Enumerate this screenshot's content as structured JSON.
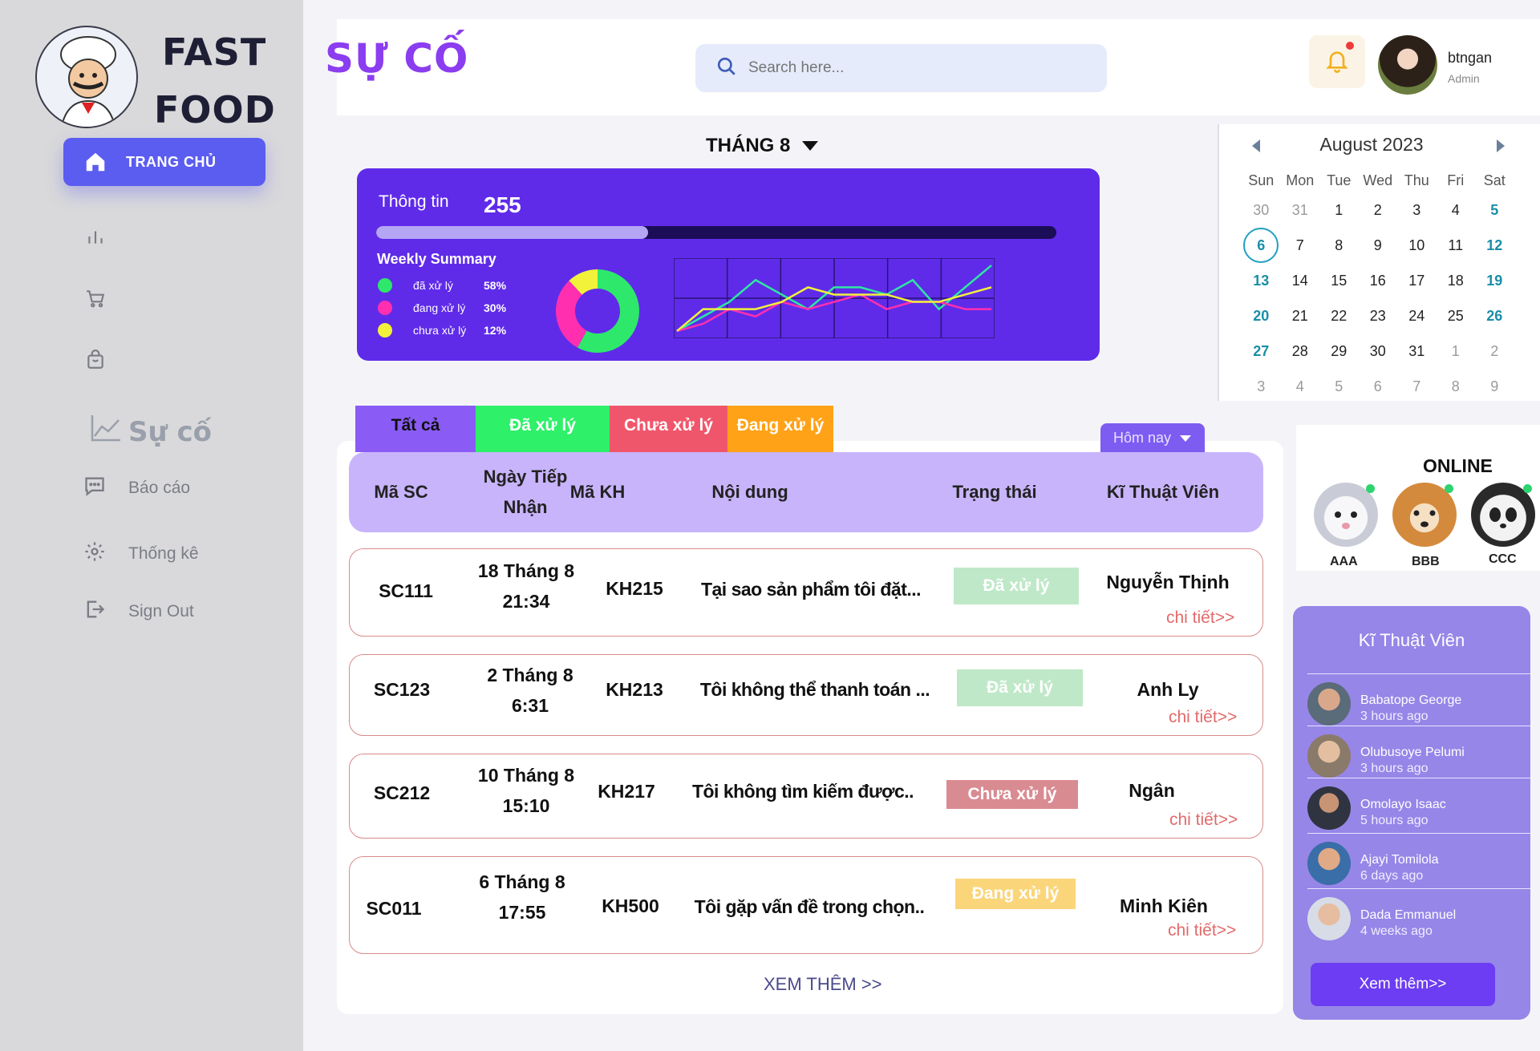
{
  "brand": {
    "line1": "FAST",
    "line2": "FOOD"
  },
  "sidebar": {
    "home_label": "TRANG CHỦ",
    "active_section": "Sự cố",
    "items": [
      {
        "label": "Báo cáo",
        "icon": "chat-icon"
      },
      {
        "label": "Thống kê",
        "icon": "gear-icon"
      },
      {
        "label": "Sign Out",
        "icon": "sign-out-icon"
      }
    ]
  },
  "header": {
    "page_title": "SỰ CỐ",
    "search_placeholder": "Search here...",
    "user_name": "btngan",
    "user_role": "Admin"
  },
  "month_selector": "THÁNG 8",
  "summary": {
    "info_label": "Thông tin",
    "info_value": "255",
    "progress": 0.4,
    "weekly_title": "Weekly Summary",
    "legend": [
      {
        "label": "đã xử lý",
        "pct": "58%",
        "color": "#2ee86b"
      },
      {
        "label": "đang xử lý",
        "pct": "30%",
        "color": "#ff2fb0"
      },
      {
        "label": "chưa xử lý",
        "pct": "12%",
        "color": "#f2f23a"
      }
    ]
  },
  "chart_data": [
    {
      "type": "pie",
      "series": [
        {
          "name": "đã xử lý",
          "value": 58
        },
        {
          "name": "đang xử lý",
          "value": 30
        },
        {
          "name": "chưa xử lý",
          "value": 12
        }
      ]
    },
    {
      "type": "line",
      "x": [
        0,
        1,
        2,
        3,
        4,
        5,
        6,
        7,
        8,
        9,
        10,
        11,
        12
      ],
      "series": [
        {
          "color": "#2ee8a0",
          "values": [
            1,
            3,
            5,
            8,
            6,
            4,
            7,
            7,
            6,
            8,
            4,
            7,
            10
          ]
        },
        {
          "color": "#ff2fb0",
          "values": [
            1,
            2,
            4,
            3,
            5,
            4,
            5,
            6,
            4,
            5,
            5,
            4,
            4
          ]
        },
        {
          "color": "#f2f23a",
          "values": [
            1,
            4,
            4,
            4,
            5,
            7,
            6,
            6,
            6,
            5,
            5,
            6,
            7
          ]
        }
      ],
      "ylim": [
        0,
        11
      ]
    }
  ],
  "calendar": {
    "title": "August 2023",
    "days": [
      "Sun",
      "Mon",
      "Tue",
      "Wed",
      "Thu",
      "Fri",
      "Sat"
    ],
    "weeks": [
      [
        "30",
        "31",
        "1",
        "2",
        "3",
        "4",
        "5"
      ],
      [
        "6",
        "7",
        "8",
        "9",
        "10",
        "11",
        "12"
      ],
      [
        "13",
        "14",
        "15",
        "16",
        "17",
        "18",
        "19"
      ],
      [
        "20",
        "21",
        "22",
        "23",
        "24",
        "25",
        "26"
      ],
      [
        "27",
        "28",
        "29",
        "30",
        "31",
        "1",
        "2"
      ],
      [
        "3",
        "4",
        "5",
        "6",
        "7",
        "8",
        "9"
      ]
    ],
    "today": "6"
  },
  "tabs": [
    {
      "label": "Tất cả",
      "bg": "#8a5cf5",
      "color": "#111"
    },
    {
      "label": "Đã xử lý",
      "bg": "#2ef069",
      "color": "#fff"
    },
    {
      "label": "Chưa xử lý",
      "bg": "#f0566b",
      "color": "#fff"
    },
    {
      "label": "Đang xử lý",
      "bg": "#ffa217",
      "color": "#fff"
    }
  ],
  "date_filter": "Hôm nay",
  "table": {
    "headers": [
      "Mã SC",
      "Ngày Tiếp Nhận",
      "Mã KH",
      "Nội dung",
      "Trạng thái",
      "Kĩ Thuật Viên"
    ],
    "detail_label": "chi tiết>>",
    "rows": [
      {
        "id": "SC111",
        "date": "18 Tháng 8",
        "time": "21:34",
        "customer": "KH215",
        "content": "Tại sao sản phẩm tôi đặt...",
        "status": "Đã xử lý",
        "status_color": "#bfe8c8",
        "tech": "Nguyễn Thịnh"
      },
      {
        "id": "SC123",
        "date": "2 Tháng 8",
        "time": "6:31",
        "customer": "KH213",
        "content": "Tôi không thể thanh toán ...",
        "status": "Đã xử lý",
        "status_color": "#bfe8c8",
        "tech": "Anh Ly"
      },
      {
        "id": "SC212",
        "date": "10 Tháng 8",
        "time": "15:10",
        "customer": "KH217",
        "content": "Tôi không tìm kiếm được..",
        "status": "Chưa xử lý",
        "status_color": "#d98b92",
        "tech": "Ngân"
      },
      {
        "id": "SC011",
        "date": "6 Tháng 8",
        "time": "17:55",
        "customer": "KH500",
        "content": "Tôi gặp vấn đề trong chọn..",
        "status": "Đang xử lý",
        "status_color": "#fbd57a",
        "tech": "Minh Kiên"
      }
    ],
    "more_label": "XEM THÊM >>"
  },
  "online": {
    "title": "ONLINE",
    "users": [
      {
        "name": "AAA"
      },
      {
        "name": "BBB"
      },
      {
        "name": "CCC"
      }
    ]
  },
  "technicians": {
    "title": "Kĩ Thuật Viên",
    "list": [
      {
        "name": "Babatope George",
        "time": "3 hours ago"
      },
      {
        "name": "Olubusoye Pelumi",
        "time": "3 hours ago"
      },
      {
        "name": "Omolayo Isaac",
        "time": "5 hours ago"
      },
      {
        "name": "Ajayi Tomilola",
        "time": "6 days ago"
      },
      {
        "name": "Dada Emmanuel",
        "time": "4 weeks ago"
      }
    ],
    "button": "Xem thêm>>"
  }
}
